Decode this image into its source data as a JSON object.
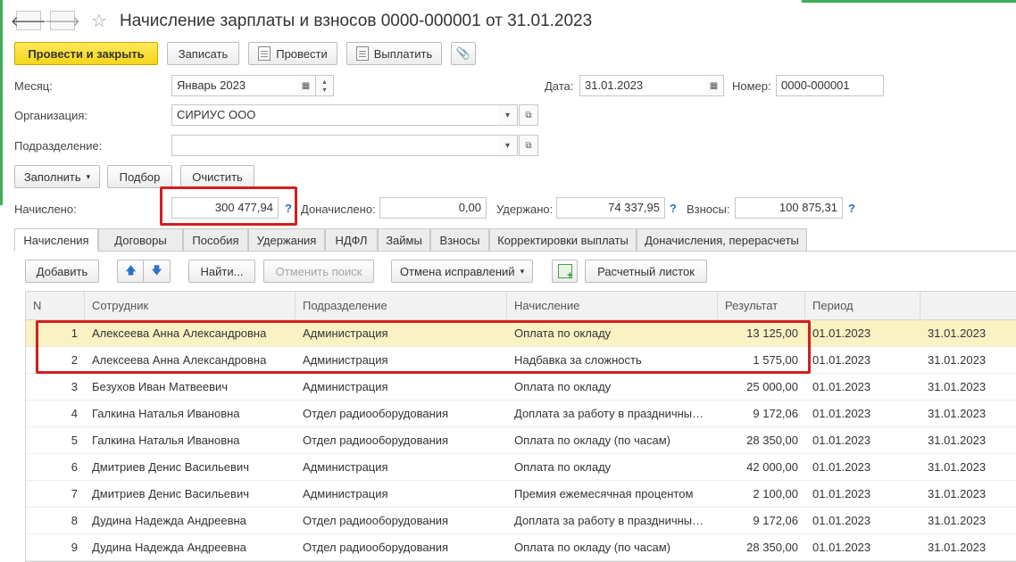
{
  "window": {
    "title": "Начисление зарплаты и взносов 0000-000001 от 31.01.2023"
  },
  "nav": {
    "back_icon": "arrow-left-icon",
    "forward_icon": "arrow-right-icon",
    "star_icon": "star-icon"
  },
  "toolbar": {
    "post_close": "Провести и закрыть",
    "save": "Записать",
    "post": "Провести",
    "pay": "Выплатить",
    "attach_icon": "paperclip-icon"
  },
  "form": {
    "month_label": "Месяц:",
    "month_value": "Январь 2023",
    "date_label": "Дата:",
    "date_value": "31.01.2023",
    "number_label": "Номер:",
    "number_value": "0000-000001",
    "org_label": "Организация:",
    "org_value": "СИРИУС ООО",
    "dept_label": "Подразделение:",
    "dept_value": ""
  },
  "actions": {
    "fill": "Заполнить",
    "pick": "Подбор",
    "clear": "Очистить"
  },
  "totals": {
    "accrued_label": "Начислено:",
    "accrued_value": "300 477,94",
    "extra_label": "Доначислено:",
    "extra_value": "0,00",
    "withheld_label": "Удержано:",
    "withheld_value": "74 337,95",
    "contrib_label": "Взносы:",
    "contrib_value": "100 875,31",
    "help": "?"
  },
  "tabs": [
    "Начисления",
    "Договоры",
    "Пособия",
    "Удержания",
    "НДФЛ",
    "Займы",
    "Взносы",
    "Корректировки выплаты",
    "Доначисления, перерасчеты"
  ],
  "table_toolbar": {
    "add": "Добавить",
    "find": "Найти...",
    "cancel_search": "Отменить поиск",
    "cancel_fixes": "Отмена исправлений",
    "payslip": "Расчетный листок"
  },
  "columns": [
    "N",
    "Сотрудник",
    "Подразделение",
    "Начисление",
    "Результат",
    "Период",
    ""
  ],
  "rows": [
    [
      "1",
      "Алексеева Анна Александровна",
      "Администрация",
      "Оплата по окладу",
      "13 125,00",
      "01.01.2023",
      "31.01.2023"
    ],
    [
      "2",
      "Алексеева Анна Александровна",
      "Администрация",
      "Надбавка за сложность",
      "1 575,00",
      "01.01.2023",
      "31.01.2023"
    ],
    [
      "3",
      "Безухов Иван Матвеевич",
      "Администрация",
      "Оплата по окладу",
      "25 000,00",
      "01.01.2023",
      "31.01.2023"
    ],
    [
      "4",
      "Галкина Наталья Ивановна",
      "Отдел радиооборудования",
      "Доплата за работу в праздничные…",
      "9 172,06",
      "01.01.2023",
      "31.01.2023"
    ],
    [
      "5",
      "Галкина Наталья Ивановна",
      "Отдел радиооборудования",
      "Оплата по окладу (по часам)",
      "28 350,00",
      "01.01.2023",
      "31.01.2023"
    ],
    [
      "6",
      "Дмитриев Денис Васильевич",
      "Администрация",
      "Оплата по окладу",
      "42 000,00",
      "01.01.2023",
      "31.01.2023"
    ],
    [
      "7",
      "Дмитриев Денис Васильевич",
      "Администрация",
      "Премия ежемесячная процентом",
      "2 100,00",
      "01.01.2023",
      "31.01.2023"
    ],
    [
      "8",
      "Дудина Надежда Андреевна",
      "Отдел радиооборудования",
      "Доплата за работу в праздничные…",
      "9 172,06",
      "01.01.2023",
      "31.01.2023"
    ],
    [
      "9",
      "Дудина Надежда Андреевна",
      "Отдел радиооборудования",
      "Оплата по окладу (по часам)",
      "28 350,00",
      "01.01.2023",
      "31.01.2023"
    ]
  ],
  "selected_row": 0,
  "colors": {
    "accent_primary": "#f5d51a",
    "highlight": "#d21f1f",
    "selection": "#fbf2c4",
    "link": "#2a72c8"
  }
}
